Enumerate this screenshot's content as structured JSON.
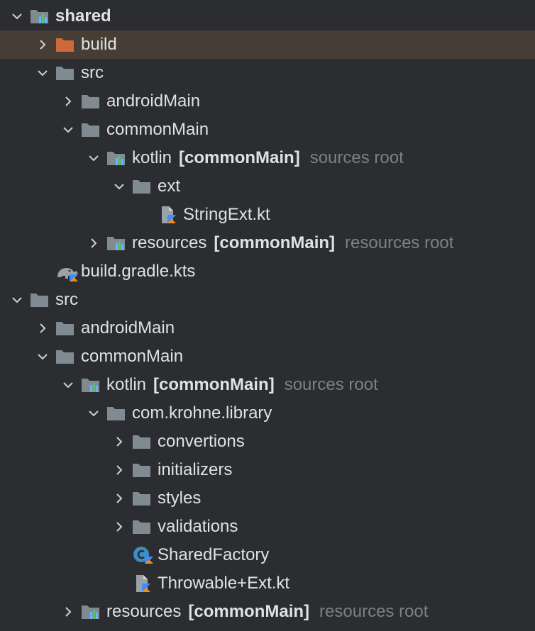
{
  "tree": {
    "rows": [
      {
        "label": "shared",
        "tag": "",
        "hint": ""
      },
      {
        "label": "build",
        "tag": "",
        "hint": ""
      },
      {
        "label": "src",
        "tag": "",
        "hint": ""
      },
      {
        "label": "androidMain",
        "tag": "",
        "hint": ""
      },
      {
        "label": "commonMain",
        "tag": "",
        "hint": ""
      },
      {
        "label": "kotlin",
        "tag": "[commonMain]",
        "hint": "sources root"
      },
      {
        "label": "ext",
        "tag": "",
        "hint": ""
      },
      {
        "label": "StringExt.kt",
        "tag": "",
        "hint": ""
      },
      {
        "label": "resources",
        "tag": "[commonMain]",
        "hint": "resources root"
      },
      {
        "label": "build.gradle.kts",
        "tag": "",
        "hint": ""
      },
      {
        "label": "src",
        "tag": "",
        "hint": ""
      },
      {
        "label": "androidMain",
        "tag": "",
        "hint": ""
      },
      {
        "label": "commonMain",
        "tag": "",
        "hint": ""
      },
      {
        "label": "kotlin",
        "tag": "[commonMain]",
        "hint": "sources root"
      },
      {
        "label": "com.krohne.library",
        "tag": "",
        "hint": ""
      },
      {
        "label": "convertions",
        "tag": "",
        "hint": ""
      },
      {
        "label": "initializers",
        "tag": "",
        "hint": ""
      },
      {
        "label": "styles",
        "tag": "",
        "hint": ""
      },
      {
        "label": "validations",
        "tag": "",
        "hint": ""
      },
      {
        "label": "SharedFactory",
        "tag": "",
        "hint": ""
      },
      {
        "label": "Throwable+Ext.kt",
        "tag": "",
        "hint": ""
      },
      {
        "label": "resources",
        "tag": "[commonMain]",
        "hint": "resources root"
      }
    ]
  },
  "colors": {
    "background": "#2b2d30",
    "selection": "#463e35",
    "folder": "#7f8b91",
    "excluded_folder": "#d1683a",
    "hint": "#7d8187",
    "kotlin_accent": "#f88a16"
  },
  "icons": {
    "module": "module-folder-icon",
    "folder": "folder-icon",
    "excluded": "excluded-folder-icon",
    "source_root": "source-root-folder-icon",
    "kotlin_file": "kotlin-file-icon",
    "gradle": "gradle-elephant-icon",
    "kotlin_class": "kotlin-class-icon"
  }
}
